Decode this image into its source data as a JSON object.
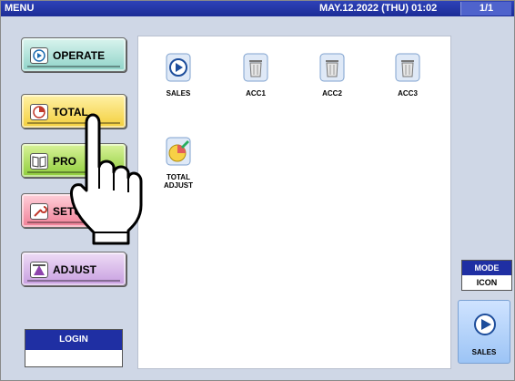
{
  "topbar": {
    "title": "MENU",
    "datetime": "MAY.12.2022 (THU) 01:02",
    "page": "1/1"
  },
  "menu": {
    "operate": "OPERATE",
    "total": "TOTAL",
    "prog": "PRO",
    "setup": "SETUP",
    "adjust": "ADJUST"
  },
  "login": {
    "label": "LOGIN"
  },
  "panel": {
    "tiles": [
      {
        "label": "SALES",
        "icon": "play-icon"
      },
      {
        "label": "ACC1",
        "icon": "trash-icon"
      },
      {
        "label": "ACC2",
        "icon": "trash-icon"
      },
      {
        "label": "ACC3",
        "icon": "trash-icon"
      },
      {
        "label_line1": "TOTAL",
        "label_line2": "ADJUST",
        "icon": "pie-pencil-icon"
      }
    ]
  },
  "mode": {
    "label": "MODE",
    "value": "ICON"
  },
  "sales_button": {
    "label": "SALES"
  },
  "colors": {
    "topbar": "#1c2c96",
    "operate": "#8fd3c8",
    "total": "#f3cf3c",
    "prog": "#8fcd3a",
    "setup": "#f07f96",
    "adjust": "#c79ee0"
  }
}
